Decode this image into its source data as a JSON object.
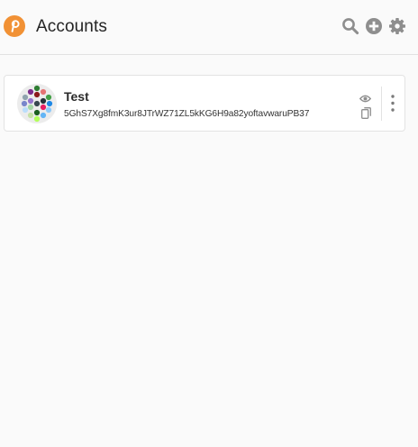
{
  "header": {
    "title": "Accounts",
    "icons": [
      "polkadot-logo-icon",
      "search-icon",
      "add-circle-icon",
      "gear-icon"
    ],
    "accent_color": "#f19135",
    "icon_color": "#8e8e8e"
  },
  "accounts": [
    {
      "name": "Test",
      "address": "5GhS7Xg8fmK3ur8JTrWZ71ZL5kKG6H9a82yoftavwaruPB37"
    }
  ]
}
